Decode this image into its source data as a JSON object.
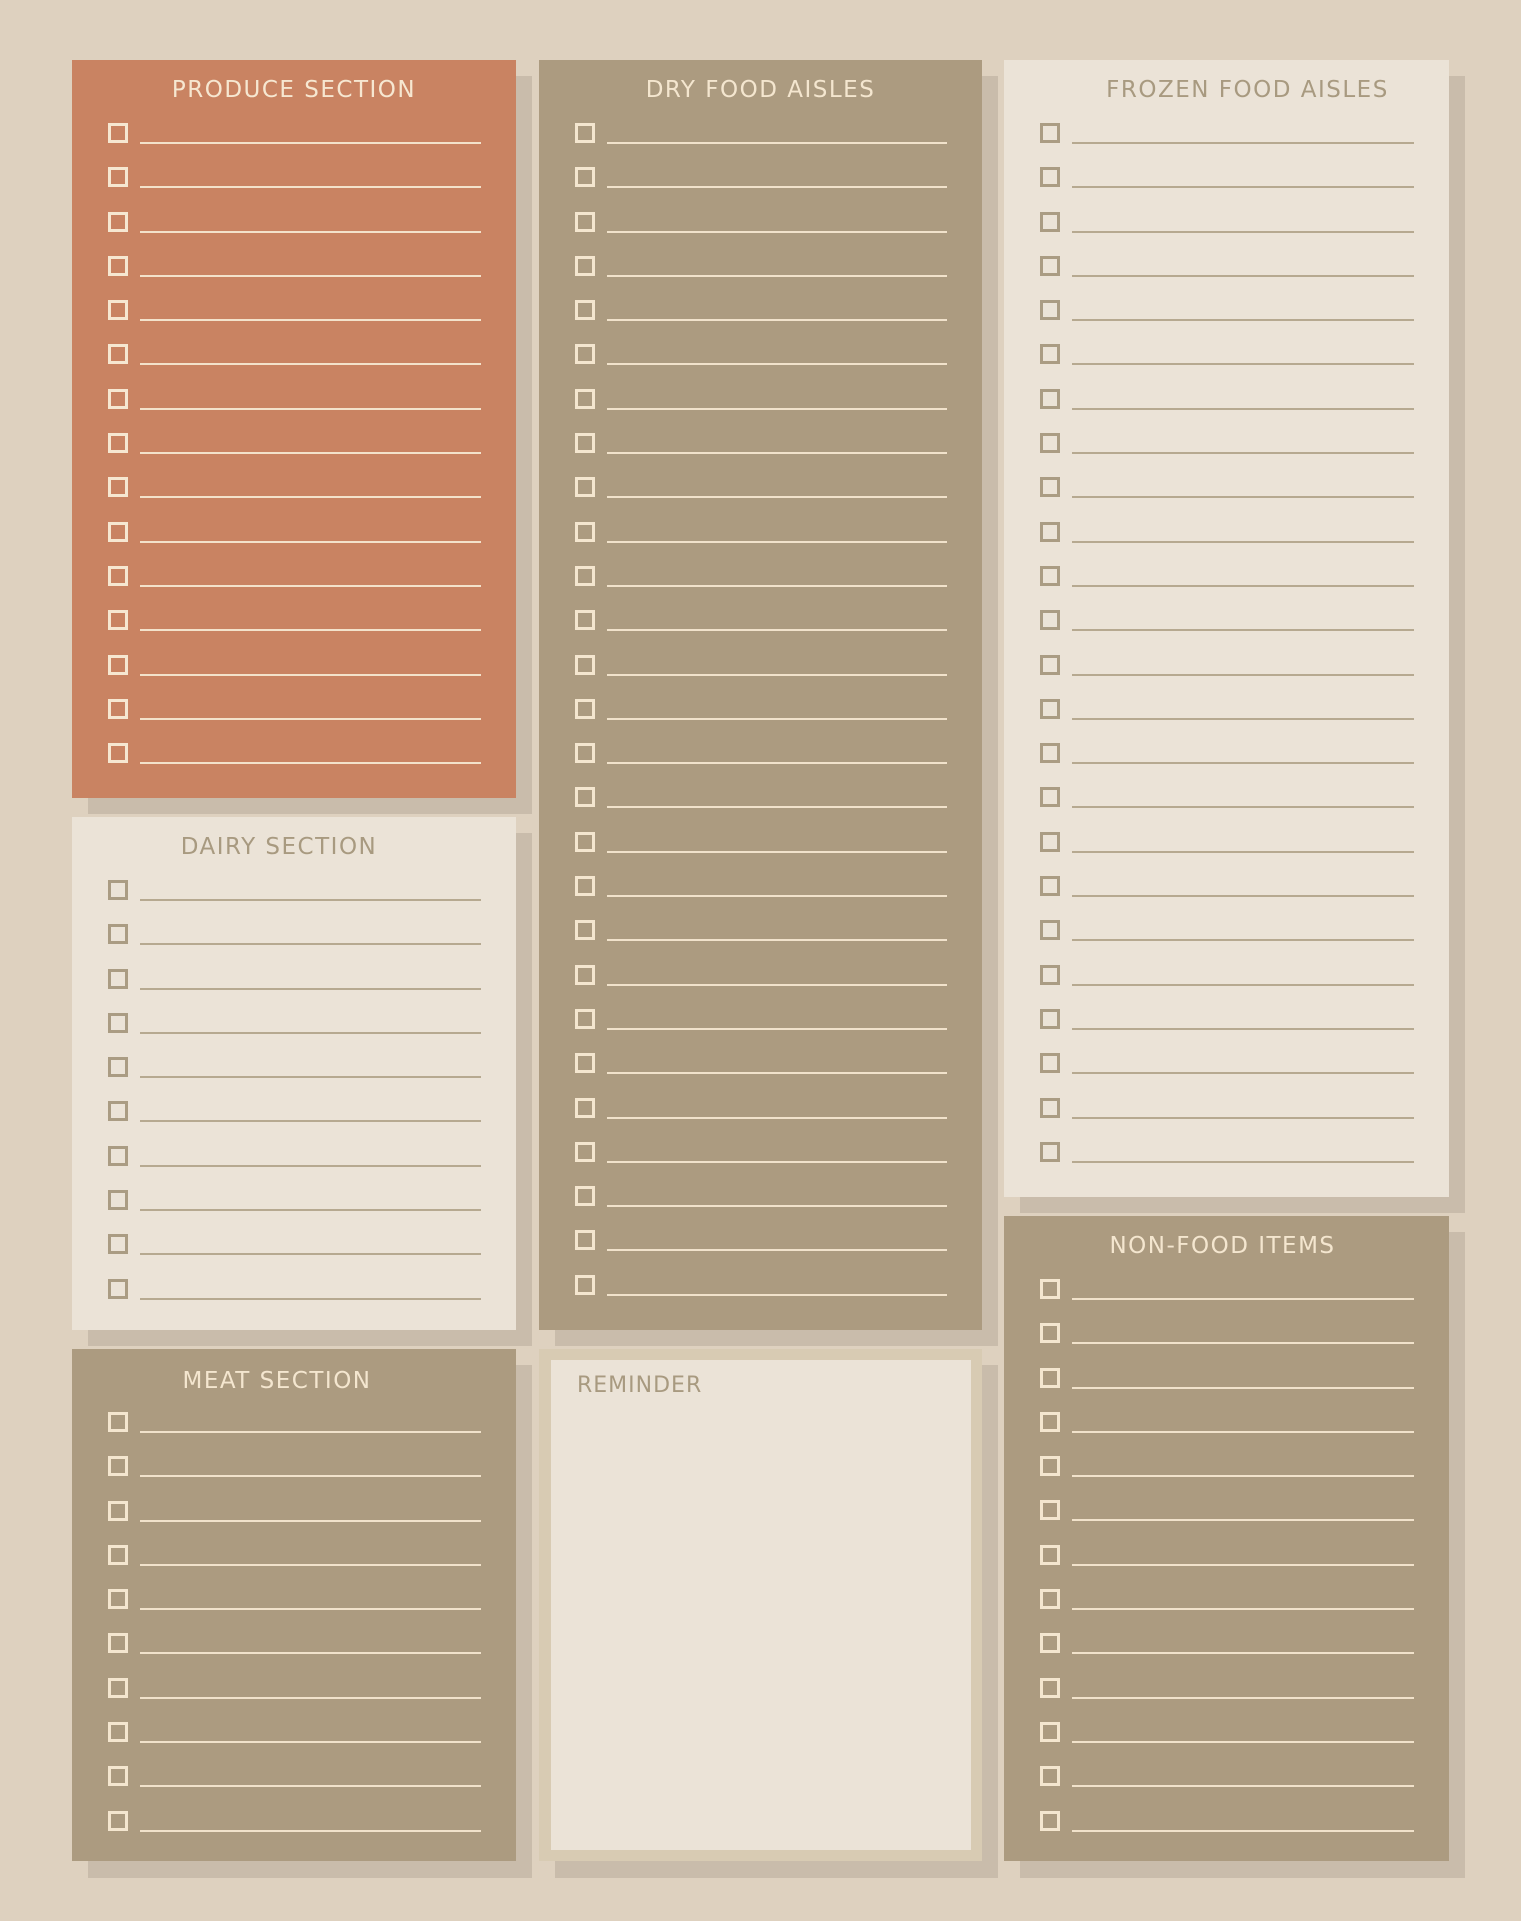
{
  "colors": {
    "background": "#ded1bf",
    "shadow": "#c9bcab",
    "terracotta": "#c98362",
    "taupe": "#ac9b80",
    "light": "#ebe3d7",
    "cream_text": "#f6e7d1",
    "muted_text": "#a89a80"
  },
  "sections": {
    "produce": {
      "title": "PRODUCE SECTION",
      "row_count": 15,
      "items": []
    },
    "dairy": {
      "title": "DAIRY SECTION",
      "row_count": 10,
      "items": []
    },
    "meat": {
      "title": "MEAT SECTION",
      "row_count": 10,
      "items": []
    },
    "dry": {
      "title": "DRY FOOD AISLES",
      "row_count": 27,
      "items": []
    },
    "frozen": {
      "title": "FROZEN FOOD AISLES",
      "row_count": 24,
      "items": []
    },
    "nonfood": {
      "title": "NON-FOOD ITEMS",
      "row_count": 13,
      "items": []
    }
  },
  "reminder": {
    "title": "REMINDER",
    "text": ""
  },
  "icons": {
    "checkbox": "empty-checkbox-icon"
  }
}
